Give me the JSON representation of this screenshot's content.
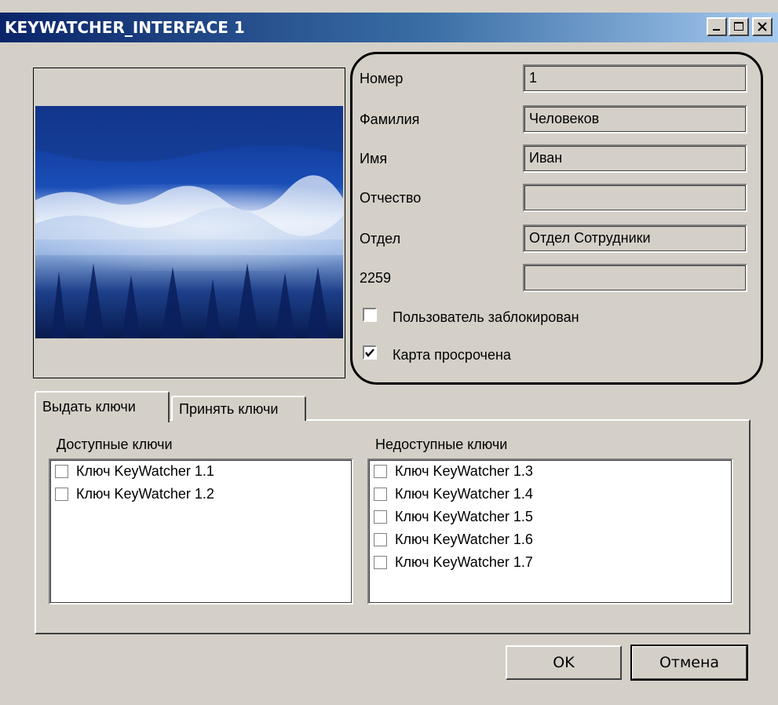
{
  "window": {
    "title": "KEYWATCHER_INTERFACE 1",
    "controls": {
      "minimize": "_",
      "maximize": "□",
      "close": "×"
    }
  },
  "photo": {
    "icon": "user-photo",
    "description_colors": [
      "#0b2a7a",
      "#c8d8f0",
      "#061a4a"
    ]
  },
  "fields": [
    {
      "key": "number",
      "label": "Номер",
      "value": "1"
    },
    {
      "key": "surname",
      "label": "Фамилия",
      "value": "Человеков"
    },
    {
      "key": "name",
      "label": "Имя",
      "value": "Иван"
    },
    {
      "key": "patronymic",
      "label": "Отчество",
      "value": ""
    },
    {
      "key": "department",
      "label": "Отдел",
      "value": "Отдел Сотрудники"
    },
    {
      "key": "code",
      "label": "2259",
      "value": ""
    }
  ],
  "checks": [
    {
      "label": "Пользователь заблокирован",
      "checked": false
    },
    {
      "label": "Карта просрочена",
      "checked": true
    }
  ],
  "tabs": [
    {
      "label": "Выдать ключи",
      "active": true
    },
    {
      "label": "Принять ключи",
      "active": false
    }
  ],
  "available": {
    "header": "Доступные ключи",
    "items": [
      "Ключ KeyWatcher 1.1",
      "Ключ KeyWatcher 1.2"
    ]
  },
  "unavailable": {
    "header": "Недоступные ключи",
    "items": [
      "Ключ KeyWatcher 1.3",
      "Ключ KeyWatcher 1.4",
      "Ключ KeyWatcher 1.5",
      "Ключ KeyWatcher 1.6",
      "Ключ KeyWatcher 1.7"
    ]
  },
  "buttons": {
    "ok": "OK",
    "cancel": "Отмена"
  },
  "colors": {
    "face": "#d4d0c8",
    "title_start": "#0a246a",
    "title_end": "#a6caf0"
  }
}
